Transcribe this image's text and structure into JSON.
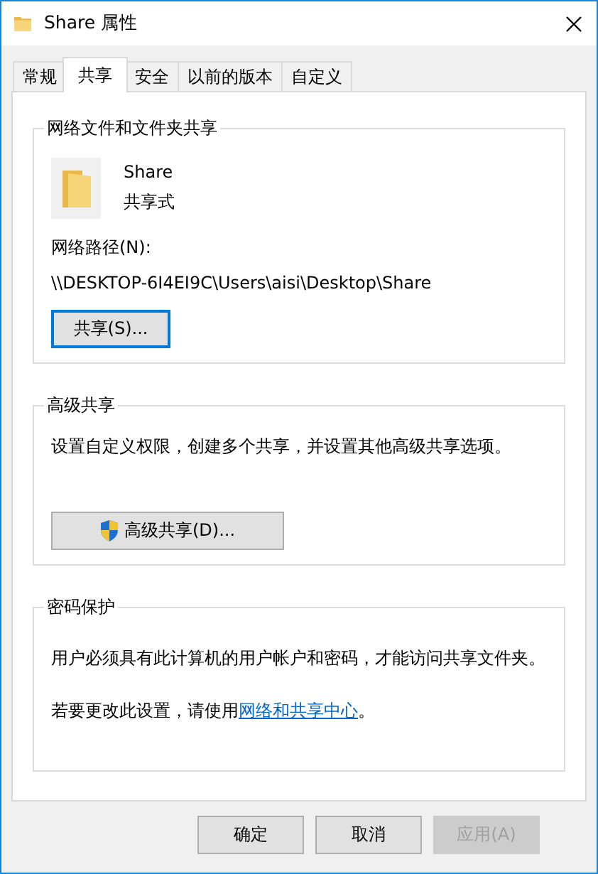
{
  "window": {
    "title": "Share 属性"
  },
  "tabs": [
    {
      "label": "常规",
      "selected": false
    },
    {
      "label": "共享",
      "selected": true
    },
    {
      "label": "安全",
      "selected": false
    },
    {
      "label": "以前的版本",
      "selected": false
    },
    {
      "label": "自定义",
      "selected": false
    }
  ],
  "network_sharing": {
    "title": "网络文件和文件夹共享",
    "item_name": "Share",
    "item_status": "共享式",
    "path_label": "网络路径(N):",
    "path": "\\\\DESKTOP-6I4EI9C\\Users\\aisi\\Desktop\\Share",
    "share_button": {
      "label": "共享(S)...",
      "focused": true
    }
  },
  "advanced_sharing": {
    "title": "高级共享",
    "description": "设置自定义权限，创建多个共享，并设置其他高级共享选项。",
    "button": {
      "label": "高级共享(D)...",
      "focused": false
    }
  },
  "password_protection": {
    "title": "密码保护",
    "description": "用户必须具有此计算机的用户帐户和密码，才能访问共享文件夹。",
    "note_before": "若要更改此设置，请使用",
    "link": "网络和共享中心",
    "note_after": "。"
  },
  "buttons": [
    {
      "label": "确定",
      "disabled": false
    },
    {
      "label": "取消",
      "disabled": false
    },
    {
      "label": "应用(A)",
      "disabled": true
    }
  ]
}
